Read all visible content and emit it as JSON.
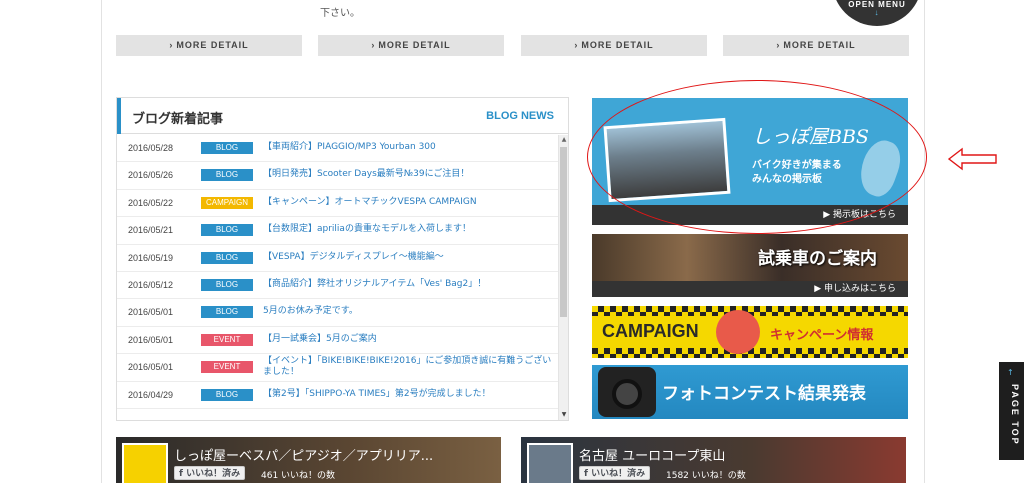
{
  "top": {
    "col1_text": "",
    "col2_text": "下さい。",
    "more_label": "MORE DETAIL",
    "open_menu_label": "OPEN MENU"
  },
  "blog": {
    "title_jp": "ブログ新着記事",
    "title_en": "BLOG NEWS",
    "items": [
      {
        "date": "2016/05/28",
        "badge": "BLOG",
        "title": "【車両紹介】PIAGGIO/MP3 Yourban 300"
      },
      {
        "date": "2016/05/26",
        "badge": "BLOG",
        "title": "【明日発売】Scooter Days最新号№39にご注目！"
      },
      {
        "date": "2016/05/22",
        "badge": "CAMPAIGN",
        "title": "【キャンペーン】オートマチックVESPA CAMPAIGN"
      },
      {
        "date": "2016/05/21",
        "badge": "BLOG",
        "title": "【台数限定】apriliaの貴重なモデルを入荷します！"
      },
      {
        "date": "2016/05/19",
        "badge": "BLOG",
        "title": "【VESPA】デジタルディスプレイ〜機能編〜"
      },
      {
        "date": "2016/05/12",
        "badge": "BLOG",
        "title": "【商品紹介】弊社オリジナルアイテム「Ves' Bag2」！"
      },
      {
        "date": "2016/05/01",
        "badge": "BLOG",
        "title": "5月のお休み予定です。"
      },
      {
        "date": "2016/05/01",
        "badge": "EVENT",
        "title": "【月一試乗会】5月のご案内"
      },
      {
        "date": "2016/05/01",
        "badge": "EVENT",
        "title": "【イベント】「BIKE!BIKE!BIKE!2016」にご参加頂き誠に有難うございました！"
      },
      {
        "date": "2016/04/29",
        "badge": "BLOG",
        "title": "【第2号】「SHIPPO-YA TIMES」第2号が完成しました！"
      }
    ]
  },
  "badge_colors": {
    "BLOG": "#2a90c8",
    "CAMPAIGN": "#f3b800",
    "EVENT": "#e8566a"
  },
  "banners": {
    "bbs_title": "しっぽ屋BBS",
    "bbs_sub1": "バイク好きが集まる",
    "bbs_sub2": "みんなの掲示板",
    "bbs_link": "▶ 掲示板はこちら",
    "test_title": "試乗車のご案内",
    "test_link": "▶ 申し込みはこちら",
    "campaign_en": "CAMPAIGN",
    "campaign_jp": "キャンペーン情報",
    "photo_title": "フォトコンテスト結果発表"
  },
  "facebook": {
    "left": {
      "name": "しっぽ屋ーベスパ／ピアジオ／アプリリア...",
      "like": "いいね！済み",
      "count": "461 いいね！の数"
    },
    "right": {
      "name": "名古屋 ユーロコープ東山",
      "like": "いいね！済み",
      "count": "1582 いいね！の数"
    }
  },
  "pagetop": {
    "label": "PAGE TOP"
  }
}
